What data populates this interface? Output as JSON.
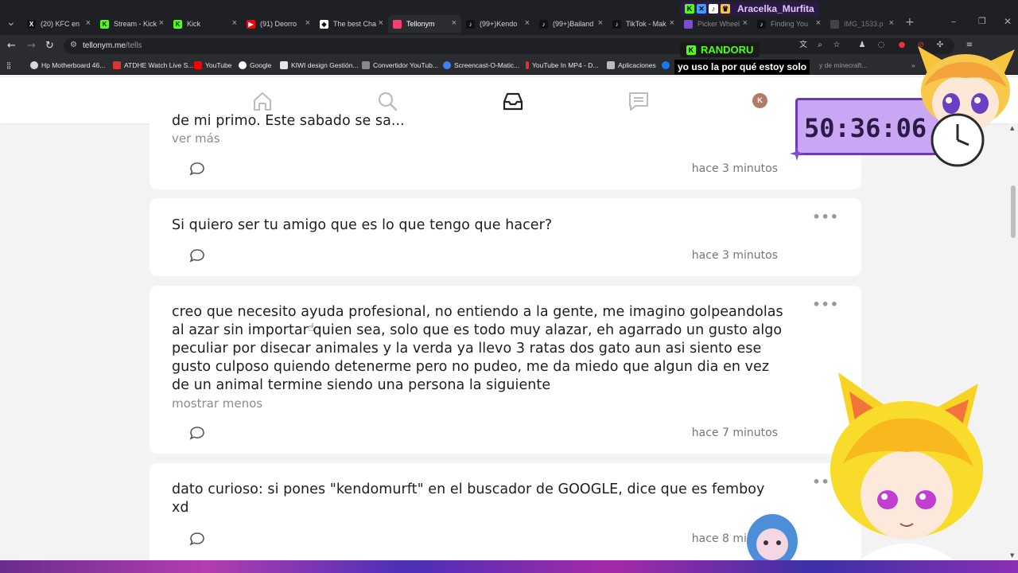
{
  "browser": {
    "tabs": [
      {
        "label": "(20) KFC en ",
        "fav": "X",
        "color": "#000000"
      },
      {
        "label": "Stream - Kick",
        "fav": "K",
        "color": "#53fc18"
      },
      {
        "label": "Kick",
        "fav": "K",
        "color": "#53fc18"
      },
      {
        "label": "(91) Deorro",
        "fav": "▶",
        "color": "#ff0000"
      },
      {
        "label": "The best Cha",
        "fav": "◆",
        "color": "#ffffff"
      },
      {
        "label": "Tellonym",
        "fav": "",
        "color": "#ff3d71"
      },
      {
        "label": "(99+)Kendo",
        "fav": "♪",
        "color": "#000000"
      },
      {
        "label": "(99+)Bailand",
        "fav": "♪",
        "color": "#000000"
      },
      {
        "label": "TikTok - Mak",
        "fav": "♪",
        "color": "#000000"
      },
      {
        "label": "Picker Wheel",
        "fav": "",
        "color": "#7b4bd1"
      },
      {
        "label": "Finding You",
        "fav": "♪",
        "color": "#000000"
      },
      {
        "label": "IMG_1533.p",
        "fav": "",
        "color": "#444444"
      }
    ],
    "url_host": "tellonym.me",
    "url_path": "/tells",
    "bookmarks": [
      {
        "label": "Hp Motherboard 46...",
        "color": "#d9d9d9"
      },
      {
        "label": "ATDHE Watch Live S...",
        "color": "#d33"
      },
      {
        "label": "YouTube",
        "color": "#ff0000"
      },
      {
        "label": "Google",
        "color": "#ffffff"
      },
      {
        "label": "KIWI design Gestión...",
        "color": "#e6e6e6"
      },
      {
        "label": "Convertidor YouTub...",
        "color": "#888888"
      },
      {
        "label": "Screencast-O-Matic...",
        "color": "#3b82f6"
      },
      {
        "label": "YouTube In MP4 - D...",
        "color": "#d33"
      },
      {
        "label": "Aplicaciones",
        "color": "#bbbbbb"
      },
      {
        "label": "",
        "color": "#1877f2"
      },
      {
        "label": "y de minecraft...",
        "color": "#888888"
      }
    ]
  },
  "tells": [
    {
      "text": "de mi primo. Este sabado se sa...",
      "toggle": "ver más",
      "time": "hace 3 minutos"
    },
    {
      "text": "Si quiero ser tu amigo que es lo que tengo que hacer?",
      "toggle": "",
      "time": "hace 3 minutos"
    },
    {
      "text": "creo que necesito ayuda profesional, no entiendo a la gente, me imagino golpeandolas al azar sin importar quien sea, solo que es todo muy alazar, eh agarrado un gusto algo peculiar por disecar animales y la verda ya llevo 3 ratas dos gato aun asi siento ese gusto culposo quiendo detenerme pero no pudeo, me da miedo que algun dia en vez de un animal termine siendo una persona la siguiente",
      "toggle": "mostrar menos",
      "time": "hace 7 minutos"
    },
    {
      "text": "dato curioso: si pones \"kendomurft\" en el buscador de  GOOGLE, dice que es femboy xd",
      "toggle": "",
      "time": "hace 8 minutos"
    }
  ],
  "nav": {
    "avatar_letter": "K"
  },
  "overlay": {
    "streamer_name": "Aracelka_Murfita",
    "chat_user": "RANDORU",
    "chat_message": "yo uso la por qué estoy solo",
    "timer": "50:36:06",
    "accent": "#c9a7f5"
  }
}
